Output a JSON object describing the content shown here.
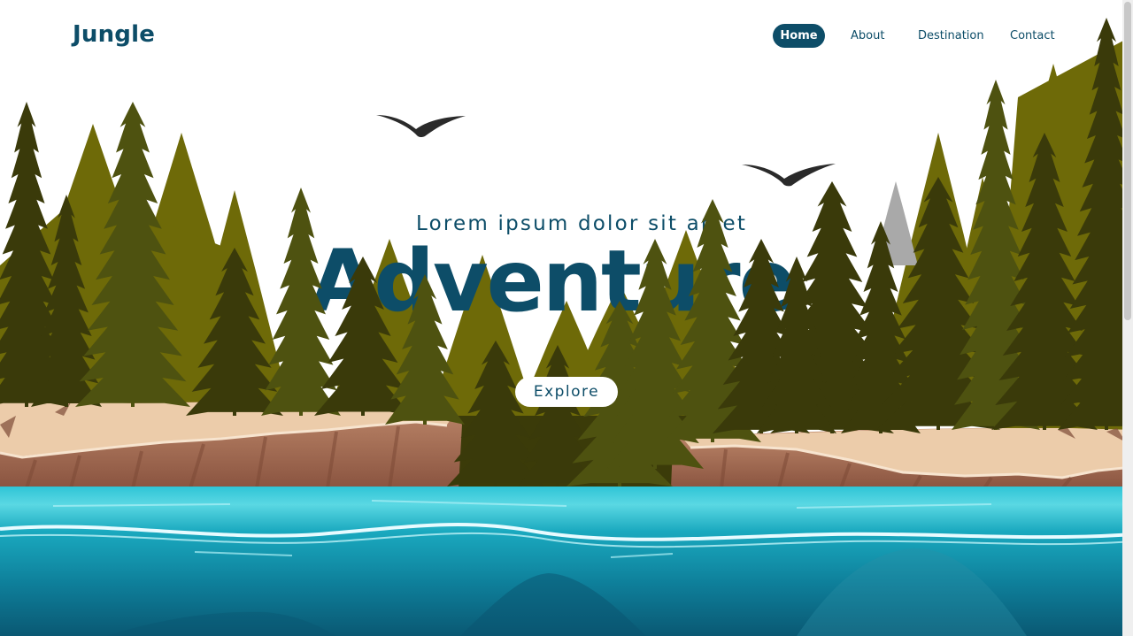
{
  "brand": "Jungle",
  "nav": {
    "items": [
      {
        "label": "Home",
        "active": true
      },
      {
        "label": "About",
        "active": false
      },
      {
        "label": "Destination",
        "active": false
      },
      {
        "label": "Contact",
        "active": false
      }
    ]
  },
  "hero": {
    "subtitle": "Lorem ipsum dolor sit amet",
    "title": "Adventure",
    "cta_label": "Explore"
  },
  "colors": {
    "brand": "#0d4d68",
    "forest_light": "#6e6a08",
    "forest_dark": "#3a3a0a",
    "forest_mid": "#4e5210",
    "cliff_top": "#ecccaa",
    "cliff_face": "#a06a50",
    "water_top": "#35c9d8",
    "water_deep": "#0a5d78"
  }
}
